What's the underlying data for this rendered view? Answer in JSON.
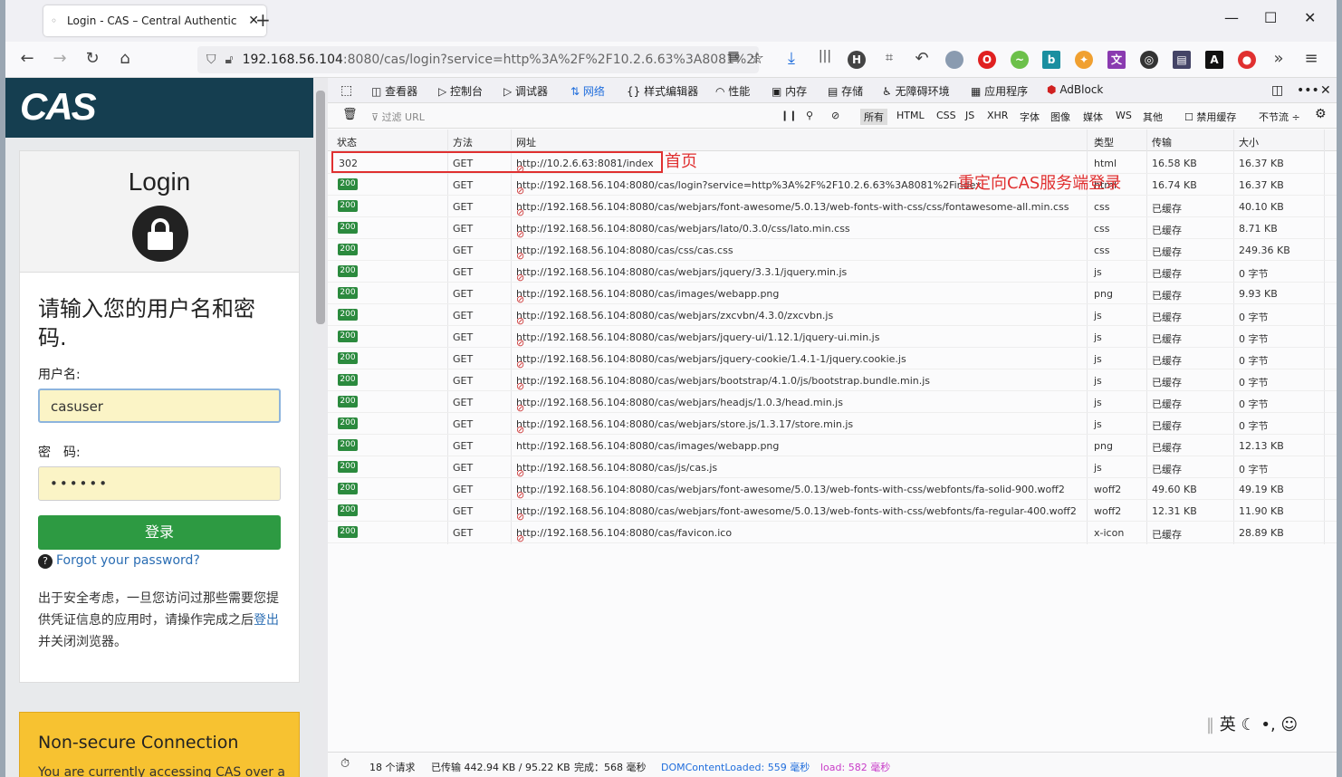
{
  "browser": {
    "tab_title": "Login - CAS – Central Authentic",
    "url_host": "192.168.56.104",
    "url_rest": ":8080/cas/login?service=http%3A%2F%2F10.2.6.63%3A8081%2Finc"
  },
  "cas": {
    "logo": "CAS",
    "login_title": "Login",
    "prompt": "请输入您的用户名和密码.",
    "username_label": "用户名:",
    "username_value": "casuser",
    "password_label": "密　码:",
    "password_value": "••••••",
    "login_button": "登录",
    "forgot": "Forgot your password?",
    "note_before": "出于安全考虑，一旦您访问过那些需要您提供凭证信息的应用时，请操作完成之后",
    "note_link": "登出",
    "note_after": "并关闭浏览器。",
    "warn_title": "Non-secure Connection",
    "warn_body": "You are currently accessing CAS over a"
  },
  "devtools": {
    "tabs": [
      "查看器",
      "控制台",
      "调试器",
      "网络",
      "样式编辑器",
      "性能",
      "内存",
      "存储",
      "无障碍环境",
      "应用程序",
      "AdBlock"
    ],
    "filter_placeholder": "过滤 URL",
    "type_filters": [
      "所有",
      "HTML",
      "CSS",
      "JS",
      "XHR",
      "字体",
      "图像",
      "媒体",
      "WS",
      "其他"
    ],
    "disable_cache": "禁用缓存",
    "throttle": "不节流 ÷",
    "columns": [
      "状态",
      "方法",
      "网址",
      "类型",
      "传输",
      "大小"
    ],
    "requests": [
      {
        "status": "302",
        "method": "GET",
        "url": "http://10.2.6.63:8081/index",
        "type": "html",
        "transfer": "16.58 KB",
        "size": "16.37 KB"
      },
      {
        "status": "200",
        "method": "GET",
        "url": "http://192.168.56.104:8080/cas/login?service=http%3A%2F%2F10.2.6.63%3A8081%2Findex",
        "type": "html",
        "transfer": "16.74 KB",
        "size": "16.37 KB"
      },
      {
        "status": "200",
        "method": "GET",
        "url": "http://192.168.56.104:8080/cas/webjars/font-awesome/5.0.13/web-fonts-with-css/css/fontawesome-all.min.css",
        "type": "css",
        "transfer": "已缓存",
        "size": "40.10 KB"
      },
      {
        "status": "200",
        "method": "GET",
        "url": "http://192.168.56.104:8080/cas/webjars/lato/0.3.0/css/lato.min.css",
        "type": "css",
        "transfer": "已缓存",
        "size": "8.71 KB"
      },
      {
        "status": "200",
        "method": "GET",
        "url": "http://192.168.56.104:8080/cas/css/cas.css",
        "type": "css",
        "transfer": "已缓存",
        "size": "249.36 KB"
      },
      {
        "status": "200",
        "method": "GET",
        "url": "http://192.168.56.104:8080/cas/webjars/jquery/3.3.1/jquery.min.js",
        "type": "js",
        "transfer": "已缓存",
        "size": "0 字节"
      },
      {
        "status": "200",
        "method": "GET",
        "url": "http://192.168.56.104:8080/cas/images/webapp.png",
        "type": "png",
        "transfer": "已缓存",
        "size": "9.93 KB"
      },
      {
        "status": "200",
        "method": "GET",
        "url": "http://192.168.56.104:8080/cas/webjars/zxcvbn/4.3.0/zxcvbn.js",
        "type": "js",
        "transfer": "已缓存",
        "size": "0 字节"
      },
      {
        "status": "200",
        "method": "GET",
        "url": "http://192.168.56.104:8080/cas/webjars/jquery-ui/1.12.1/jquery-ui.min.js",
        "type": "js",
        "transfer": "已缓存",
        "size": "0 字节"
      },
      {
        "status": "200",
        "method": "GET",
        "url": "http://192.168.56.104:8080/cas/webjars/jquery-cookie/1.4.1-1/jquery.cookie.js",
        "type": "js",
        "transfer": "已缓存",
        "size": "0 字节"
      },
      {
        "status": "200",
        "method": "GET",
        "url": "http://192.168.56.104:8080/cas/webjars/bootstrap/4.1.0/js/bootstrap.bundle.min.js",
        "type": "js",
        "transfer": "已缓存",
        "size": "0 字节"
      },
      {
        "status": "200",
        "method": "GET",
        "url": "http://192.168.56.104:8080/cas/webjars/headjs/1.0.3/head.min.js",
        "type": "js",
        "transfer": "已缓存",
        "size": "0 字节"
      },
      {
        "status": "200",
        "method": "GET",
        "url": "http://192.168.56.104:8080/cas/webjars/store.js/1.3.17/store.min.js",
        "type": "js",
        "transfer": "已缓存",
        "size": "0 字节"
      },
      {
        "status": "200",
        "method": "GET",
        "url": "http://192.168.56.104:8080/cas/images/webapp.png",
        "type": "png",
        "transfer": "已缓存",
        "size": "12.13 KB"
      },
      {
        "status": "200",
        "method": "GET",
        "url": "http://192.168.56.104:8080/cas/js/cas.js",
        "type": "js",
        "transfer": "已缓存",
        "size": "0 字节"
      },
      {
        "status": "200",
        "method": "GET",
        "url": "http://192.168.56.104:8080/cas/webjars/font-awesome/5.0.13/web-fonts-with-css/webfonts/fa-solid-900.woff2",
        "type": "woff2",
        "transfer": "49.60 KB",
        "size": "49.19 KB"
      },
      {
        "status": "200",
        "method": "GET",
        "url": "http://192.168.56.104:8080/cas/webjars/font-awesome/5.0.13/web-fonts-with-css/webfonts/fa-regular-400.woff2",
        "type": "woff2",
        "transfer": "12.31 KB",
        "size": "11.90 KB"
      },
      {
        "status": "200",
        "method": "GET",
        "url": "http://192.168.56.104:8080/cas/favicon.ico",
        "type": "x-icon",
        "transfer": "已缓存",
        "size": "28.89 KB"
      }
    ],
    "annotation_home": "首页",
    "annotation_redirect": "重定向CAS服务端登录",
    "status": {
      "requests": "18 个请求",
      "transferred": "已传输 442.94 KB / 95.22 KB",
      "finish": "完成：568 毫秒",
      "domcontent": "DOMContentLoaded: 559 毫秒",
      "load": "load: 582 毫秒"
    },
    "ime": "英"
  }
}
